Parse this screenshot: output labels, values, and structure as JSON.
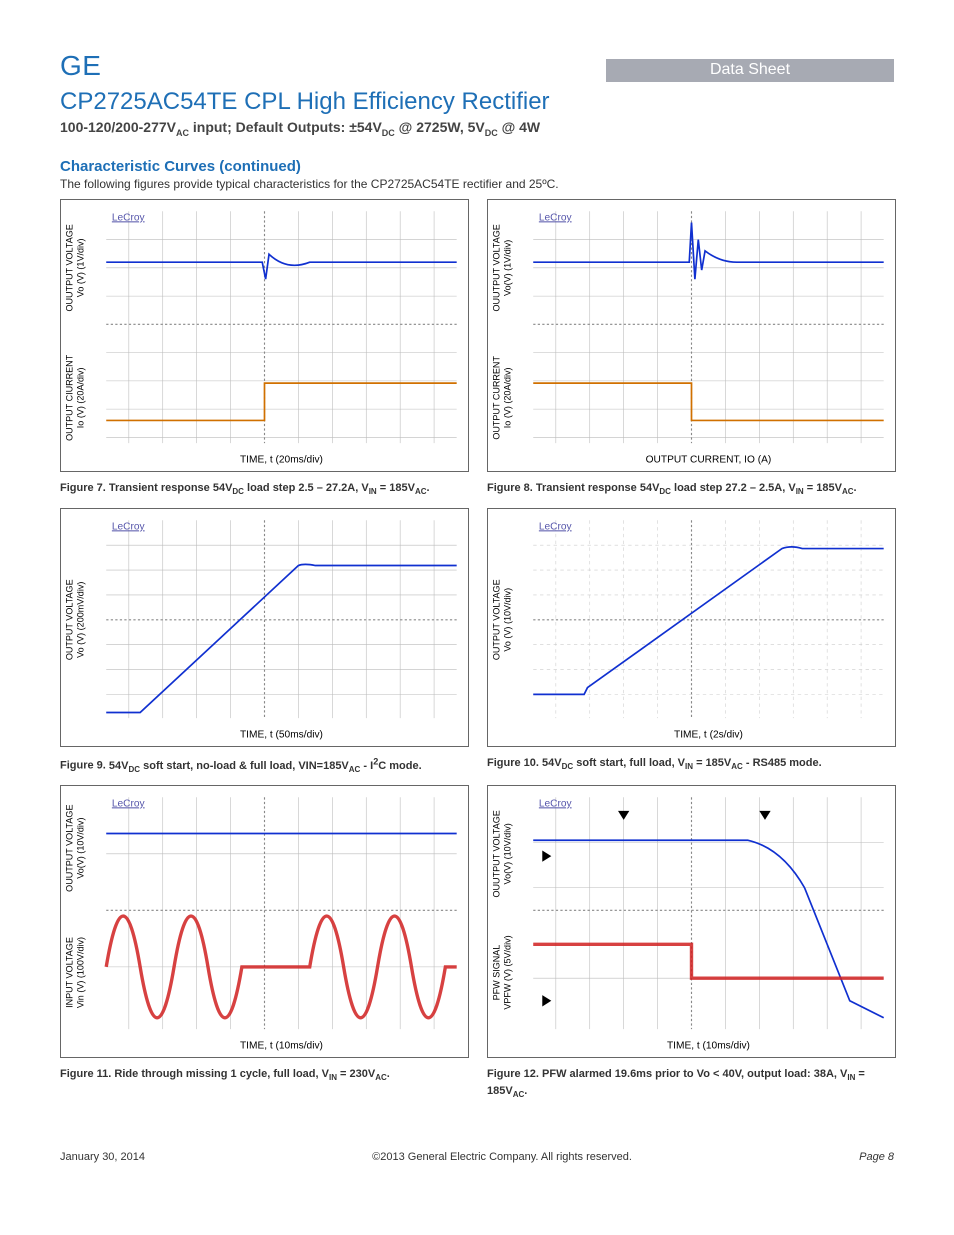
{
  "header": {
    "logo": "GE",
    "doc_type": "Data Sheet",
    "title": "CP2725AC54TE  CPL High Efficiency Rectifier",
    "subtitle_html": "100-120/200-277V<sub>AC</sub> input; Default Outputs: ±54V<sub>DC</sub> @ 2725W, 5V<sub>DC</sub> @ 4W"
  },
  "section": {
    "heading": "Characteristic Curves (continued)",
    "intro": "The following figures provide typical characteristics for the CP2725AC54TE rectifier and 25ºC."
  },
  "figures": {
    "f7": {
      "num": "Figure 7.",
      "caption_html": "Transient response 54V<sub>DC</sub> load step 2.5 – 27.2A, V<sub>IN</sub> = 185V<sub>AC</sub>.",
      "y1_label": "OUUTPUT VOLTAGE",
      "y1_sub": "Vo (V) (1V/div)",
      "y2_label": "OUTPUT CIURRENT",
      "y2_sub": "Io (V) (20A/div)",
      "x_label": "TIME, t (20ms/div)",
      "scope_brand": "LeCroy"
    },
    "f8": {
      "num": "Figure 8.",
      "caption_html": "Transient response 54V<sub>DC</sub> load step 27.2 – 2.5A, V<sub>IN</sub> = 185V<sub>AC</sub>.",
      "y1_label": "OUUTPUT VOLTAGE",
      "y1_sub": "Vo(V) (1V/div)",
      "y2_label": "OUTPUT CURRENT",
      "y2_sub": "Io (V) (20A/div)",
      "x_label": "OUTPUT CURRENT, IO (A)",
      "scope_brand": "LeCroy"
    },
    "f9": {
      "num": "Figure 9.",
      "caption_html": "54V<sub>DC</sub> soft start, no-load & full load, VIN=185V<sub>AC</sub> - I<sup>2</sup>C mode.",
      "y1_label": "OUTPUT VOLTAGE",
      "y1_sub": "Vo (V) (200mV/div)",
      "x_label": "TIME, t (50ms/div)",
      "scope_brand": "LeCroy"
    },
    "f10": {
      "num": "Figure 10.",
      "caption_html": "54V<sub>DC</sub> soft start, full load, V<sub>IN</sub> = 185V<sub>AC</sub> - RS485 mode.",
      "y1_label": "OUTPUT VOLTAGE",
      "y1_sub": "Vo (V) (10V/div)",
      "x_label": "TIME, t (2s/div)",
      "scope_brand": "LeCroy"
    },
    "f11": {
      "num": "Figure 11.",
      "caption_html": "Ride through missing 1 cycle, full load, V<sub>IN</sub> =  230V<sub>AC</sub>.",
      "y1_label": "OUUTPUT VOLTAGE",
      "y1_sub": "Vo(V) (10V/div)",
      "y2_label": "INPUT VOLTAGE",
      "y2_sub": "Vin (V) (100V/div)",
      "x_label": "TIME, t (10ms/div)",
      "scope_brand": "LeCroy"
    },
    "f12": {
      "num": "Figure 12.",
      "caption_html": "PFW alarmed 19.6ms prior to Vo < 40V, output load: 38A, V<sub>IN</sub> = 185V<sub>AC</sub>.",
      "y1_label": "OUUTPUT VOLTAGE",
      "y1_sub": "Vo(V) (10V/div)",
      "y2_label": "PFW SIGNAL",
      "y2_sub": "VPFW (V) (5V/div)",
      "x_label": "TIME, t (10ms/div)",
      "scope_brand": "LeCroy"
    }
  },
  "chart_data": [
    {
      "id": "figure-7",
      "type": "oscilloscope",
      "title": "Transient response 54VDC load step 2.5 – 27.2A, VIN = 185VAC",
      "x": {
        "label": "TIME, t",
        "scale": "20ms/div",
        "divisions": 10
      },
      "traces": [
        {
          "name": "Output Voltage",
          "unit": "V",
          "scale": "1V/div",
          "color": "#1030d0",
          "description": "Flat near +1div above center, brief dip (~-1V) at load step then small ringing back to nominal"
        },
        {
          "name": "Output Current",
          "unit": "A",
          "scale": "20A/div",
          "color": "#d07000",
          "description": "Step from 2.5A to 27.2A at center of trace"
        }
      ]
    },
    {
      "id": "figure-8",
      "type": "oscilloscope",
      "title": "Transient response 54VDC load step 27.2 – 2.5A, VIN = 185VAC",
      "x": {
        "label": "OUTPUT CURRENT, IO",
        "unit": "A",
        "divisions": 10
      },
      "traces": [
        {
          "name": "Output Voltage",
          "unit": "V",
          "scale": "1V/div",
          "color": "#1030d0",
          "description": "Flat, overshoot spike (~+1.5V) with decaying ring at step"
        },
        {
          "name": "Output Current",
          "unit": "A",
          "scale": "20A/div",
          "color": "#d07000",
          "description": "Step down from 27.2A to 2.5A at center"
        }
      ]
    },
    {
      "id": "figure-9",
      "type": "oscilloscope",
      "title": "54VDC soft start, no-load & full load, VIN=185VAC - I2C mode",
      "x": {
        "label": "TIME, t",
        "scale": "50ms/div",
        "divisions": 10
      },
      "traces": [
        {
          "name": "Output Voltage",
          "unit": "mV",
          "scale": "200mV/div",
          "color": "#1030d0",
          "description": "Linear ramp from bottom-left to a flat top at about +2 div, starting ~1 div in"
        }
      ]
    },
    {
      "id": "figure-10",
      "type": "oscilloscope",
      "title": "54VDC soft start, full load, VIN = 185VAC - RS485 mode",
      "x": {
        "label": "TIME, t",
        "scale": "2s/div",
        "divisions": 10
      },
      "traces": [
        {
          "name": "Output Voltage",
          "unit": "V",
          "scale": "10V/div",
          "color": "#1030d0",
          "description": "Flat near zero until ~1.5div, then linear ramp up to ~54V (top plateau) by ~7div"
        }
      ]
    },
    {
      "id": "figure-11",
      "type": "oscilloscope",
      "title": "Ride through missing 1 cycle, full load, VIN = 230VAC",
      "x": {
        "label": "TIME, t",
        "scale": "10ms/div",
        "divisions": 10
      },
      "traces": [
        {
          "name": "Output Voltage",
          "unit": "V",
          "scale": "10V/div",
          "color": "#1030d0",
          "description": "Nearly flat at ~54V with very slight droop during the missing cycle window"
        },
        {
          "name": "Input Voltage",
          "unit": "V",
          "scale": "100V/div",
          "color": "#d02020",
          "description": "230VAC sinusoid with one full cycle dropped (gap) near center, thick noisy trace"
        }
      ]
    },
    {
      "id": "figure-12",
      "type": "oscilloscope",
      "title": "PFW alarmed 19.6ms prior to Vo < 40V, output load 38A, VIN = 185VAC",
      "x": {
        "label": "TIME, t",
        "scale": "10ms/div",
        "divisions": 10
      },
      "traces": [
        {
          "name": "Output Voltage",
          "unit": "V",
          "scale": "10V/div",
          "color": "#1030d0",
          "description": "Flat high, then decays toward ~40V crossing ~19.6ms after PFW drop"
        },
        {
          "name": "PFW Signal",
          "unit": "V",
          "scale": "5V/div",
          "color": "#d02020",
          "description": "High (~5V) then steps low at center; noisy baseline"
        }
      ],
      "markers": [
        {
          "type": "time-cursor",
          "pair": true
        },
        {
          "type": "voltage-cursor",
          "pair": true
        }
      ]
    }
  ],
  "footer": {
    "date": "January 30, 2014",
    "copyright": "©2013 General Electric Company. All rights reserved.",
    "page": "Page 8"
  }
}
